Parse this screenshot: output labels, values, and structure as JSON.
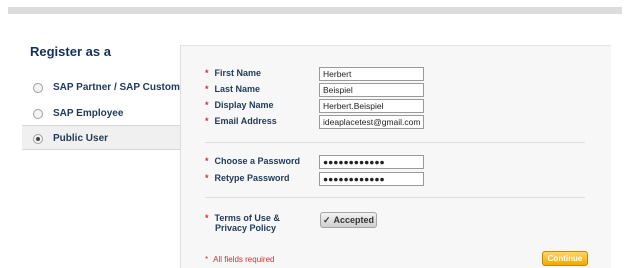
{
  "left": {
    "title": "Register as a",
    "options": [
      {
        "label": "SAP Partner / SAP Customer",
        "selected": false
      },
      {
        "label": "SAP Employee",
        "selected": false
      },
      {
        "label": "Public User",
        "selected": true
      }
    ]
  },
  "form": {
    "required_marker": "*",
    "first_name": {
      "label": "First Name",
      "value": "Herbert"
    },
    "last_name": {
      "label": "Last Name",
      "value": "Beispiel"
    },
    "display_name": {
      "label": "Display Name",
      "value": "Herbert.Beispiel"
    },
    "email": {
      "label": "Email Address",
      "value": "ideaplacetest@gmail.com"
    },
    "password": {
      "label": "Choose a Password",
      "value": "●●●●●●●●●●●●"
    },
    "retype_password": {
      "label": "Retype Password",
      "value": "●●●●●●●●●●●●"
    },
    "terms": {
      "label_line1": "Terms of Use &",
      "label_line2": "Privacy Policy",
      "button": "Accepted",
      "check": "✓"
    },
    "all_required": "All fields required",
    "continue": "Continue"
  },
  "colors": {
    "required": "#cc3333",
    "accent": "#f5a800",
    "text": "#1f3a57"
  }
}
